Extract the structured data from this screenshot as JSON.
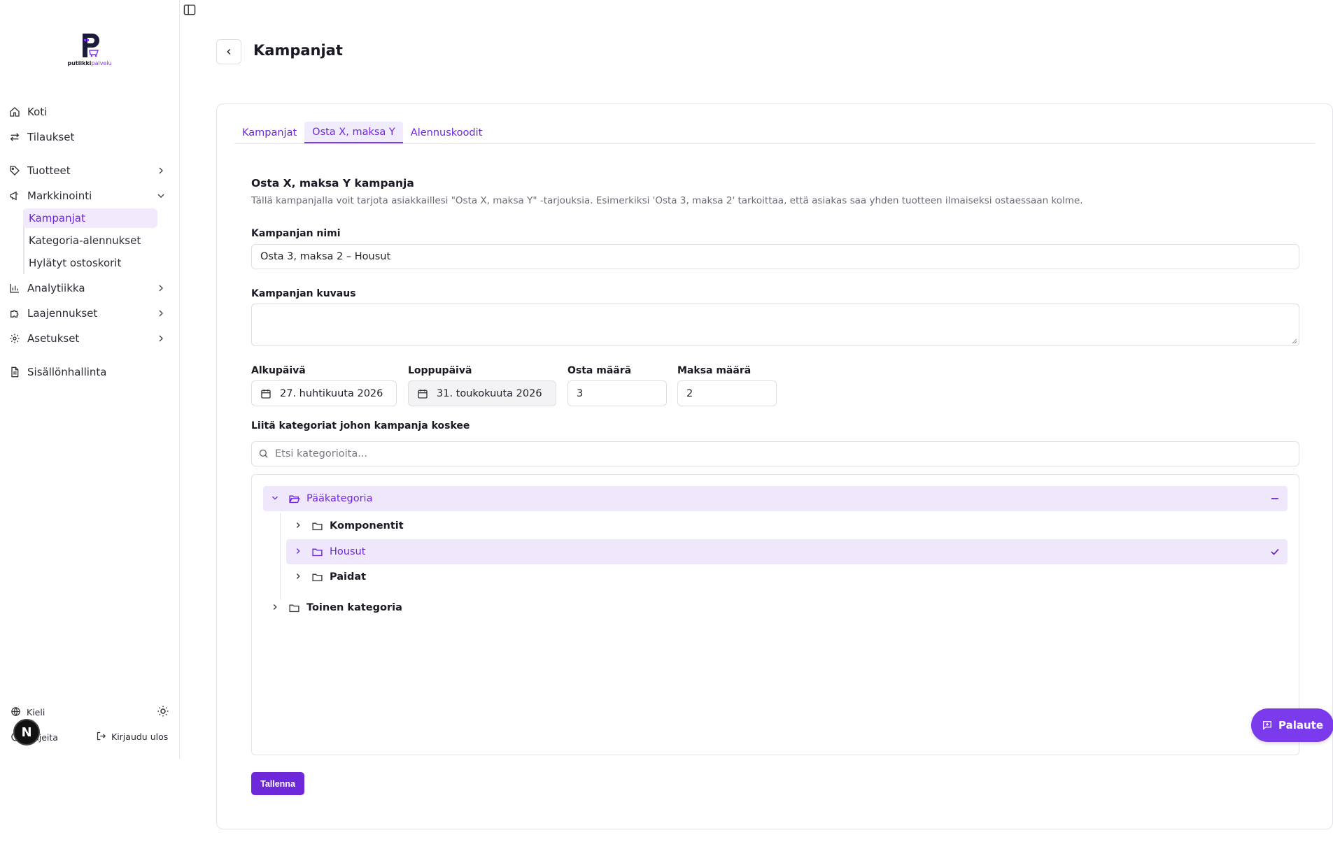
{
  "sidebar": {
    "brand_main": "putiikki",
    "brand_accent": "palvelu",
    "items": [
      {
        "label": "Koti",
        "icon": "home-icon"
      },
      {
        "label": "Tilaukset",
        "icon": "arrows-exchange-icon"
      },
      {
        "label": "Tuotteet",
        "icon": "tag-icon"
      },
      {
        "label": "Markkinointi",
        "icon": "megaphone-icon"
      },
      {
        "label": "Analytiikka",
        "icon": "bar-chart-icon"
      },
      {
        "label": "Laajennukset",
        "icon": "puzzle-icon"
      },
      {
        "label": "Asetukset",
        "icon": "gear-icon"
      },
      {
        "label": "Sisällönhallinta",
        "icon": "document-icon"
      }
    ],
    "marketing_sub": [
      "Kampanjat",
      "Kategoria-alennukset",
      "Hylätyt ostoskorit"
    ],
    "language_label": "Kieli",
    "help_label": "Ohjeita",
    "logout_label": "Kirjaudu ulos",
    "badge_letter": "N"
  },
  "header": {
    "title": "Kampanjat"
  },
  "tabs": [
    "Kampanjat",
    "Osta X, maksa Y",
    "Alennuskoodit"
  ],
  "form": {
    "section_title": "Osta X, maksa Y kampanja",
    "section_desc": "Tällä kampanjalla voit tarjota asiakkaillesi \"Osta X, maksa Y\" -tarjouksia. Esimerkiksi 'Osta 3, maksa 2' tarkoittaa, että asiakas saa yhden tuotteen ilmaiseksi ostaessaan kolme.",
    "name_label": "Kampanjan nimi",
    "name_value": "Osta 3, maksa 2 – Housut",
    "desc_label": "Kampanjan kuvaus",
    "desc_value": "",
    "start_label": "Alkupäivä",
    "start_value": "27. huhtikuuta 2026",
    "end_label": "Loppupäivä",
    "end_value": "31. toukokuuta 2026",
    "buy_label": "Osta määrä",
    "buy_value": "3",
    "pay_label": "Maksa määrä",
    "pay_value": "2",
    "categories_label": "Liitä kategoriat johon kampanja koskee",
    "category_search_placeholder": "Etsi kategorioita...",
    "save_label": "Tallenna"
  },
  "tree": {
    "root": "Pääkategoria",
    "children": [
      "Komponentit",
      "Housut",
      "Paidat"
    ],
    "second_root": "Toinen kategoria"
  },
  "feedback_label": "Palaute",
  "colors": {
    "accent": "#7c3aed",
    "accent_dark": "#6d28d9",
    "selected_bg": "#efe8fc"
  }
}
